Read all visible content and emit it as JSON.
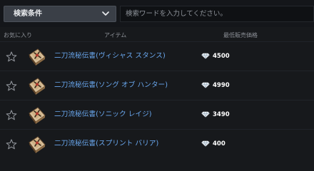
{
  "search": {
    "filter_label": "検索条件",
    "placeholder": "検索ワードを入力してください。"
  },
  "columns": {
    "favorite": "お気に入り",
    "item": "アイテム",
    "price": "最低販売価格"
  },
  "items": [
    {
      "name": "二刀流秘伝書(ヴィシャス スタンス)",
      "price": "4500"
    },
    {
      "name": "二刀流秘伝書(ソング オブ ハンター)",
      "price": "4990"
    },
    {
      "name": "二刀流秘伝書(ソニック レイジ)",
      "price": "3490"
    },
    {
      "name": "二刀流秘伝書(スプリント バリア)",
      "price": "400"
    }
  ],
  "icons": {
    "filter_chevron": "chevron-down-icon",
    "favorite": "star-outline-icon",
    "item": "skill-book-icon",
    "currency": "diamond-currency-icon"
  },
  "colors": {
    "background": "#17191c",
    "item_name": "#69a7ee",
    "price": "#ffffff",
    "muted": "#8d9198"
  }
}
